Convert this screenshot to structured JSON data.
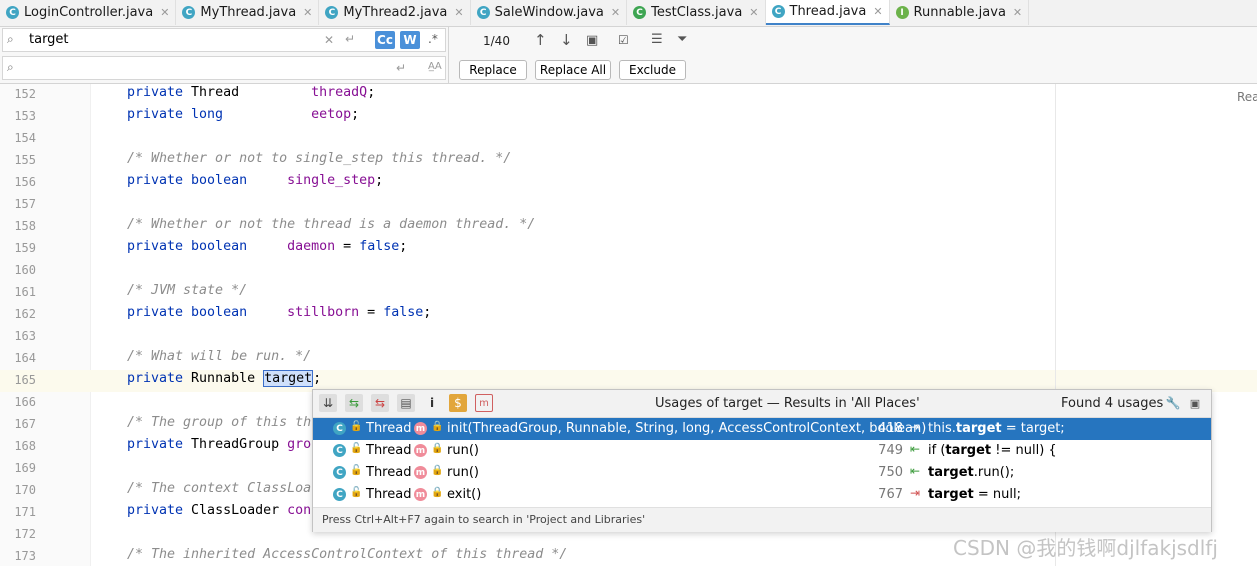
{
  "tabs": [
    {
      "label": "LoginController.java",
      "icon": "C",
      "color": "#40a5c3",
      "active": false
    },
    {
      "label": "MyThread.java",
      "icon": "C",
      "color": "#40a5c3",
      "active": false
    },
    {
      "label": "MyThread2.java",
      "icon": "C",
      "color": "#40a5c3",
      "active": false
    },
    {
      "label": "SaleWindow.java",
      "icon": "C",
      "color": "#40a5c3",
      "active": false
    },
    {
      "label": "TestClass.java",
      "icon": "C",
      "color": "#3ea552",
      "active": false
    },
    {
      "label": "Thread.java",
      "icon": "C",
      "color": "#40a5c3",
      "active": true
    },
    {
      "label": "Runnable.java",
      "icon": "I",
      "color": "#6cb24a",
      "active": false
    }
  ],
  "find": {
    "search_value": "target",
    "replace_value": "",
    "match_case": "Cc",
    "words": "W",
    "regex": ".*",
    "counter": "1/40",
    "buttons": {
      "replace": "Replace",
      "replace_all": "Replace All",
      "exclude": "Exclude"
    }
  },
  "editor": {
    "reader_label": "Rea",
    "lines": [
      {
        "n": "152",
        "code": [
          [
            "kw",
            "private "
          ],
          [
            "ty",
            "Thread         "
          ],
          [
            "fld",
            "threadQ"
          ],
          [
            "ty",
            ";"
          ]
        ]
      },
      {
        "n": "153",
        "code": [
          [
            "kw",
            "private long           "
          ],
          [
            "fld",
            "eetop"
          ],
          [
            "ty",
            ";"
          ]
        ]
      },
      {
        "n": "154",
        "code": []
      },
      {
        "n": "155",
        "code": [
          [
            "cm",
            "/* Whether or not to single_step this thread. */"
          ]
        ]
      },
      {
        "n": "156",
        "code": [
          [
            "kw",
            "private boolean     "
          ],
          [
            "fld",
            "single_step"
          ],
          [
            "ty",
            ";"
          ]
        ]
      },
      {
        "n": "157",
        "code": []
      },
      {
        "n": "158",
        "code": [
          [
            "cm",
            "/* Whether or not the thread is a daemon thread. */"
          ]
        ]
      },
      {
        "n": "159",
        "code": [
          [
            "kw",
            "private boolean     "
          ],
          [
            "fld",
            "daemon"
          ],
          [
            "ty",
            " = "
          ],
          [
            "kw",
            "false"
          ],
          [
            "ty",
            ";"
          ]
        ]
      },
      {
        "n": "160",
        "code": []
      },
      {
        "n": "161",
        "code": [
          [
            "cm",
            "/* JVM state */"
          ]
        ]
      },
      {
        "n": "162",
        "code": [
          [
            "kw",
            "private boolean     "
          ],
          [
            "fld",
            "stillborn"
          ],
          [
            "ty",
            " = "
          ],
          [
            "kw",
            "false"
          ],
          [
            "ty",
            ";"
          ]
        ]
      },
      {
        "n": "163",
        "code": []
      },
      {
        "n": "164",
        "code": [
          [
            "cm",
            "/* What will be run. */"
          ]
        ]
      },
      {
        "n": "165",
        "current": true,
        "code": [
          [
            "kw",
            "private "
          ],
          [
            "ty",
            "Runnable "
          ],
          [
            "hl",
            "target"
          ],
          [
            "ty",
            ";"
          ]
        ]
      },
      {
        "n": "166",
        "code": []
      },
      {
        "n": "167",
        "code": [
          [
            "cm",
            "/* The group of this th"
          ]
        ]
      },
      {
        "n": "168",
        "code": [
          [
            "kw",
            "private "
          ],
          [
            "ty",
            "ThreadGroup "
          ],
          [
            "fld",
            "gro"
          ]
        ]
      },
      {
        "n": "169",
        "code": []
      },
      {
        "n": "170",
        "code": [
          [
            "cm",
            "/* The context ClassLoa"
          ]
        ]
      },
      {
        "n": "171",
        "code": [
          [
            "kw",
            "private "
          ],
          [
            "ty",
            "ClassLoader "
          ],
          [
            "fld",
            "con"
          ]
        ]
      },
      {
        "n": "172",
        "code": []
      },
      {
        "n": "173",
        "code": [
          [
            "cm",
            "/* The inherited AccessControlContext of this thread */"
          ]
        ]
      }
    ]
  },
  "usages": {
    "title": "Usages of target — Results in 'All Places'",
    "found": "Found 4 usages",
    "footer": "Press Ctrl+Alt+F7 again to search in 'Project and Libraries'",
    "rows": [
      {
        "cls": "Thread",
        "method": "init(ThreadGroup, Runnable, String, long, AccessControlContext, boolean)",
        "line": "418",
        "pre": "this.",
        "bold": "target",
        "post": " = target;",
        "write": true,
        "selected": true
      },
      {
        "cls": "Thread",
        "method": "run()",
        "line": "749",
        "pre": "if (",
        "bold": "target",
        "post": " != null) {",
        "write": false,
        "selected": false
      },
      {
        "cls": "Thread",
        "method": "run()",
        "line": "750",
        "pre": "",
        "bold": "target",
        "post": ".run();",
        "write": false,
        "selected": false
      },
      {
        "cls": "Thread",
        "method": "exit()",
        "line": "767",
        "pre": "",
        "bold": "target",
        "post": " = null;",
        "write": true,
        "selected": false
      }
    ]
  },
  "watermark": "CSDN @我的钱啊djlfakjsdlfj"
}
